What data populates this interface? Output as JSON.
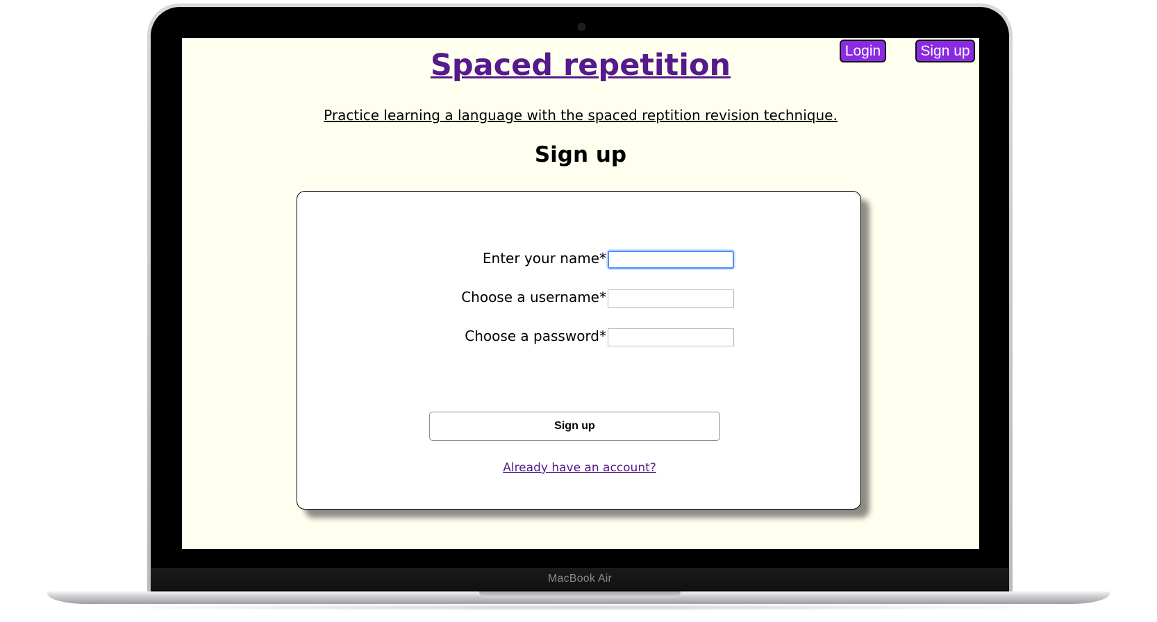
{
  "device": {
    "brand_label": "MacBook Air"
  },
  "nav": {
    "login_label": "Login",
    "signup_label": "Sign up"
  },
  "header": {
    "title": "Spaced repetition",
    "tagline": "Practice learning a language with the spaced reptition revision technique."
  },
  "page": {
    "heading": "Sign up"
  },
  "form": {
    "fields": [
      {
        "label": "Enter your name*",
        "value": "",
        "focused": true
      },
      {
        "label": "Choose a username*",
        "value": ""
      },
      {
        "label": "Choose a password*",
        "value": ""
      }
    ],
    "submit_label": "Sign up",
    "account_link": "Already have an account?"
  },
  "colors": {
    "page_background": "#fffff0",
    "nav_button_bg": "#8a2be2",
    "link_visited": "#551a8b",
    "focus_ring": "#4d90fe"
  }
}
